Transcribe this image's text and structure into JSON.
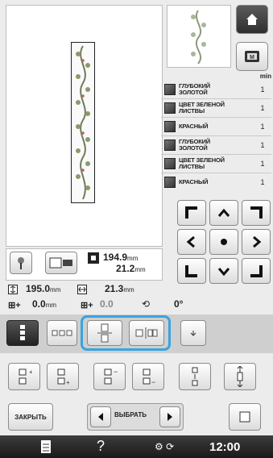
{
  "colors": {
    "accent_ring": "#3aa3e0",
    "dark_button": "#2f2f2f",
    "background": "#ececec"
  },
  "header": {
    "home_icon": "home-icon",
    "memory_icon": "memory-icon"
  },
  "color_list": {
    "header_label": "min",
    "items": [
      {
        "name": "ГЛУБОКИЙ\nЗОЛОТОЙ",
        "count": "1"
      },
      {
        "name": "ЦВЕТ ЗЕЛЕНОЙ\nЛИСТВЫ",
        "count": "1"
      },
      {
        "name": "КРАСНЫЙ",
        "count": "1"
      },
      {
        "name": "ГЛУБОКИЙ\nЗОЛОТОЙ",
        "count": "1"
      },
      {
        "name": "ЦВЕТ ЗЕЛЕНОЙ\nЛИСТВЫ",
        "count": "1"
      },
      {
        "name": "КРАСНЫЙ",
        "count": "1"
      }
    ]
  },
  "size": {
    "height_value": "194.9",
    "height_unit": "mm",
    "width_value": "21.2",
    "width_unit": "mm",
    "total_height_value": "195.0",
    "total_height_unit": "mm",
    "total_width_value": "21.3",
    "total_width_unit": "mm",
    "offset_value": "0.0",
    "offset_unit": "mm",
    "hidden_offset_value": "0.0",
    "angle_value": "0°"
  },
  "footer": {
    "close_label": "ЗАКРЫТЬ",
    "select_label": "ВЫБРАТЬ",
    "help_label": "?",
    "time": "12:00"
  }
}
